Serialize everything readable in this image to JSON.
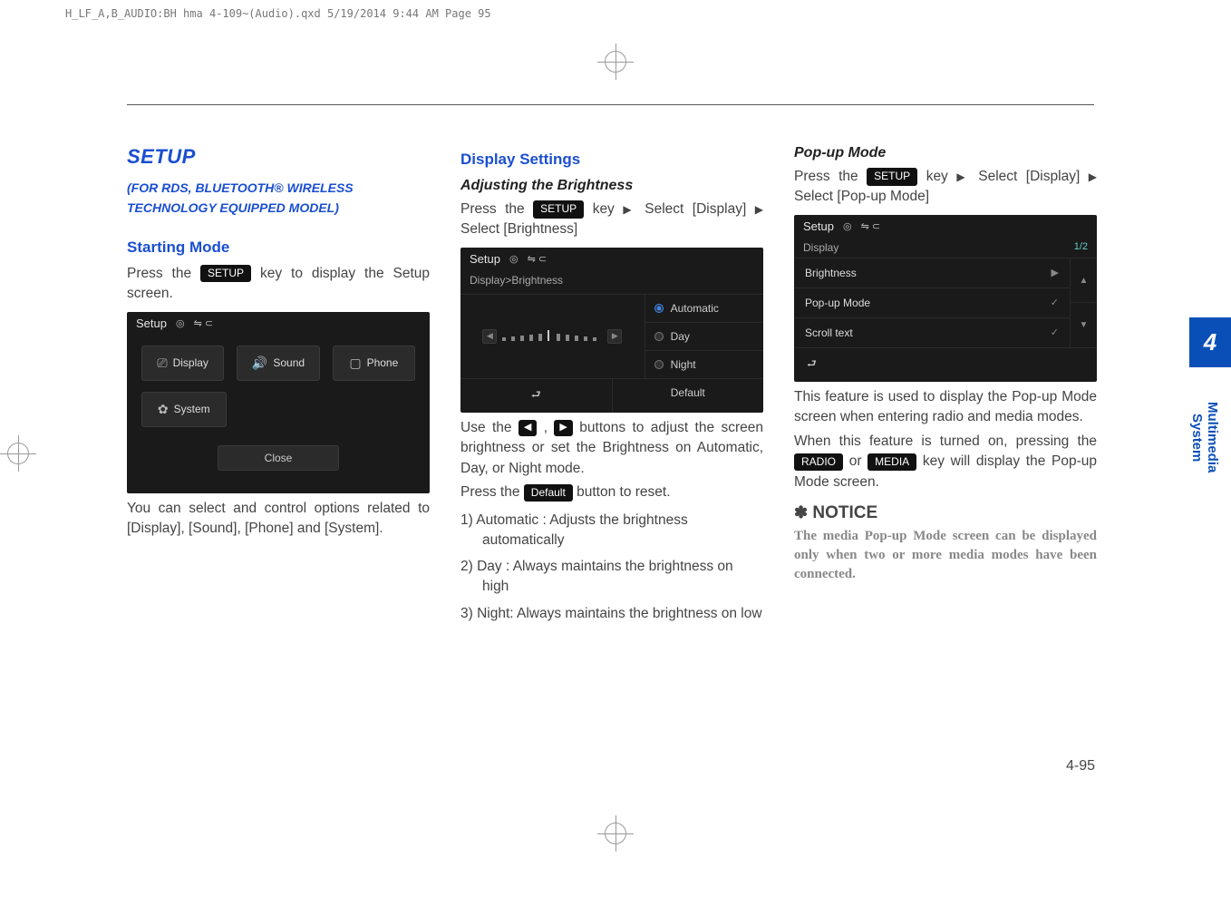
{
  "header_note": "H_LF_A,B_AUDIO:BH hma 4-109~(Audio).qxd  5/19/2014  9:44 AM  Page 95",
  "side_tab": {
    "number": "4",
    "label": "Multimedia System"
  },
  "page_number": "4-95",
  "col1": {
    "title": "SETUP",
    "subtitle_l1": "(FOR RDS, BLUETOOTH® WIRELESS",
    "subtitle_l2": "TECHNOLOGY EQUIPPED MODEL)",
    "heading": "Starting Mode",
    "p1a": "Press the ",
    "p1_key": "SETUP",
    "p1b": " key to display the Setup screen.",
    "ss": {
      "title": "Setup",
      "icon_disc": "◎",
      "icon_bt": "⇋ ⊂",
      "display": "Display",
      "sound": "Sound",
      "phone": "Phone",
      "system": "System",
      "close": "Close"
    },
    "caption": "You can select and control options related to [Display], [Sound], [Phone] and [System]."
  },
  "col2": {
    "heading": "Display Settings",
    "sub1": "Adjusting the Brightness",
    "p1a": "Press the ",
    "p1_key": "SETUP",
    "p1b": " key",
    "p1_tri": "▶",
    "p1c": "Select [Display]",
    "p1d": "Select [Brightness]",
    "ss": {
      "title": "Setup",
      "crumb": "Display>Brightness",
      "automatic": "Automatic",
      "day": "Day",
      "night": "Night",
      "back": "⮐",
      "default": "Default"
    },
    "p2a": "Use the ",
    "p2_left": "◀",
    "p2_right": "▶",
    "p2b": " buttons to adjust the screen brightness or set the Brightness on Automatic, Day, or Night mode.",
    "p3a": "Press the ",
    "p3_key": "Default",
    "p3b": " button to reset.",
    "li1": "1) Automatic : Adjusts the brightness automatically",
    "li2": "2) Day : Always maintains the bright­ness on high",
    "li3": "3) Night: Always maintains the brightness on low"
  },
  "col3": {
    "sub1": "Pop-up Mode",
    "p1a": "Press the ",
    "p1_key": "SETUP",
    "p1b": " key",
    "p1_tri": "▶",
    "p1c": "Select [Display]",
    "p1d": "Select [Pop-up Mode]",
    "ss": {
      "title": "Setup",
      "display": "Display",
      "page": "1/2",
      "brightness": "Brightness",
      "popup": "Pop-up Mode",
      "scroll": "Scroll text",
      "back": "⮐"
    },
    "p2": "This feature is used to display the Pop-up Mode screen when entering radio and media modes.",
    "p3a": "When this feature is turned on, pressing the ",
    "p3_key1": "RADIO",
    "p3b": " or ",
    "p3_key2": "MEDIA",
    "p3c": " key will display the Pop-up Mode screen.",
    "notice_star": "✽",
    "notice_hd": "NOTICE",
    "notice_body": "The media Pop-up Mode screen can be displayed only when two or more media modes have been connected."
  }
}
